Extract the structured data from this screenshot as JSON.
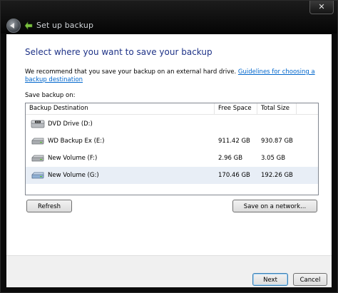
{
  "window": {
    "title": "Set up backup",
    "close_glyph": "✕"
  },
  "main": {
    "heading": "Select where you want to save your backup",
    "recommendation": "We recommend that you save your backup on an external hard drive.",
    "guidelines_link": "Guidelines for choosing a backup destination",
    "save_on_label": "Save backup on:"
  },
  "table": {
    "columns": [
      "Backup Destination",
      "Free Space",
      "Total Size"
    ],
    "rows": [
      {
        "icon": "dvd-drive-icon",
        "name": "DVD Drive (D:)",
        "free": "",
        "total": "",
        "selected": false
      },
      {
        "icon": "hard-drive-icon",
        "name": "WD Backup Ex  (E:)",
        "free": "911.42 GB",
        "total": "930.87 GB",
        "selected": false
      },
      {
        "icon": "hard-drive-icon",
        "name": "New Volume (F:)",
        "free": "2.96 GB",
        "total": "3.05 GB",
        "selected": false
      },
      {
        "icon": "hard-drive-icon",
        "name": "New Volume (G:)",
        "free": "170.46 GB",
        "total": "192.26 GB",
        "selected": true
      }
    ]
  },
  "buttons": {
    "refresh": "Refresh",
    "save_network": "Save on a network...",
    "next": "Next",
    "cancel": "Cancel"
  },
  "colors": {
    "heading": "#1e3287",
    "link": "#0066cc",
    "selected_row": "#e8eef6",
    "title_bar": "#0b0b0b"
  }
}
